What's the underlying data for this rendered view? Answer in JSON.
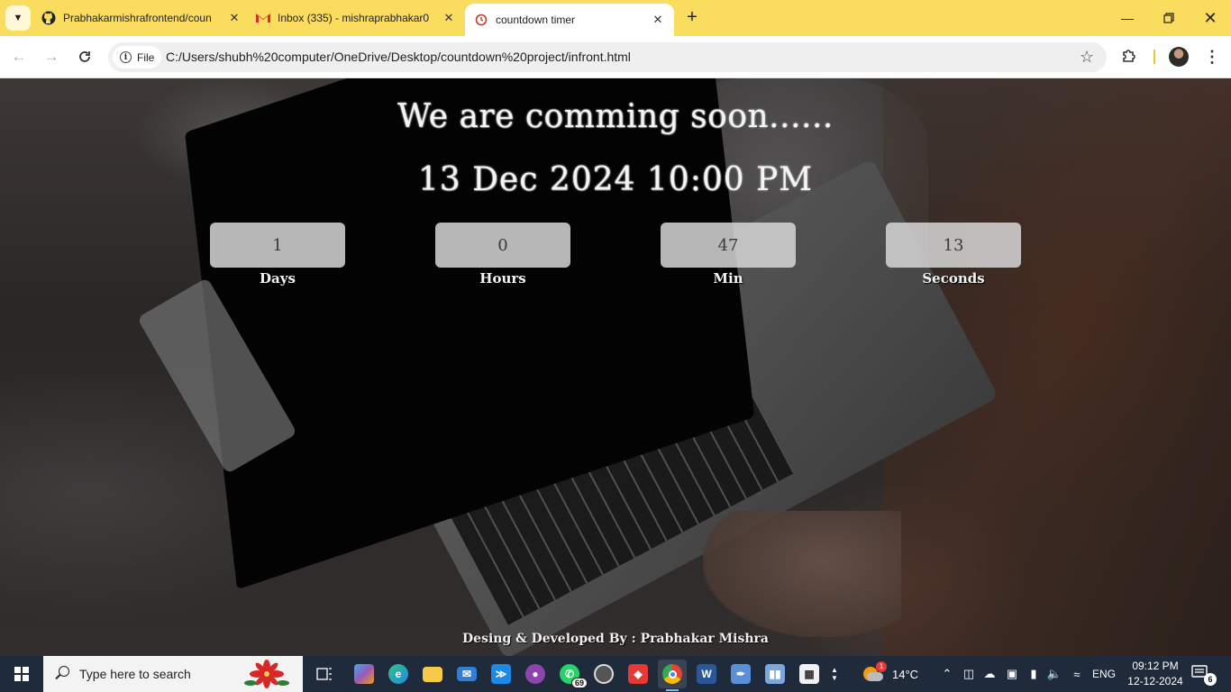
{
  "browser": {
    "tabs": [
      {
        "title": "Prabhakarmishrafrontend/coun",
        "icon": "github-icon"
      },
      {
        "title": "Inbox (335) - mishraprabhakar0",
        "icon": "gmail-icon"
      },
      {
        "title": "countdown timer",
        "icon": "page-icon",
        "active": true
      }
    ],
    "scheme_chip": "File",
    "url": "C:/Users/shubh%20computer/OneDrive/Desktop/countdown%20project/infront.html"
  },
  "page": {
    "heading": "We are comming soon......",
    "launch_date": "13 Dec 2024 10:00 PM",
    "countdown": [
      {
        "value": "1",
        "label": "Days"
      },
      {
        "value": "0",
        "label": "Hours"
      },
      {
        "value": "47",
        "label": "Min"
      },
      {
        "value": "13",
        "label": "Seconds"
      }
    ],
    "footer": "Desing & Developed By : Prabhakar Mishra"
  },
  "taskbar": {
    "search_placeholder": "Type here to search",
    "whatsapp_badge": "69",
    "weather_temp": "14°C",
    "language": "ENG",
    "time": "09:12 PM",
    "date": "12-12-2024",
    "notifications_count": "6",
    "weather_alert_count": "1"
  },
  "colors": {
    "tabbar": "#fadc5e",
    "taskbar": "#1f2b3a",
    "countdown_box": "#d7d7d7"
  }
}
